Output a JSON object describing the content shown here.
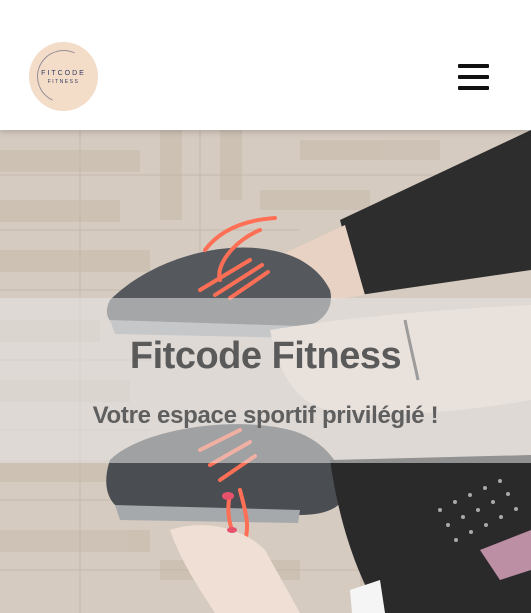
{
  "header": {
    "logo": {
      "main_text": "FITCODE",
      "sub_text": "FITNESS"
    },
    "menu_icon": "hamburger-menu-icon"
  },
  "hero": {
    "title": "Fitcode Fitness",
    "subtitle": "Votre espace sportif privilégié !",
    "image": "woman-tying-running-shoes-on-wooden-floor",
    "overlay_color": "#e6e6e6"
  },
  "colors": {
    "logo_background": "#f3dcc8",
    "logo_text": "#333a63",
    "text": "#5a5a5a",
    "shoe_laces": "#ff6f55"
  }
}
